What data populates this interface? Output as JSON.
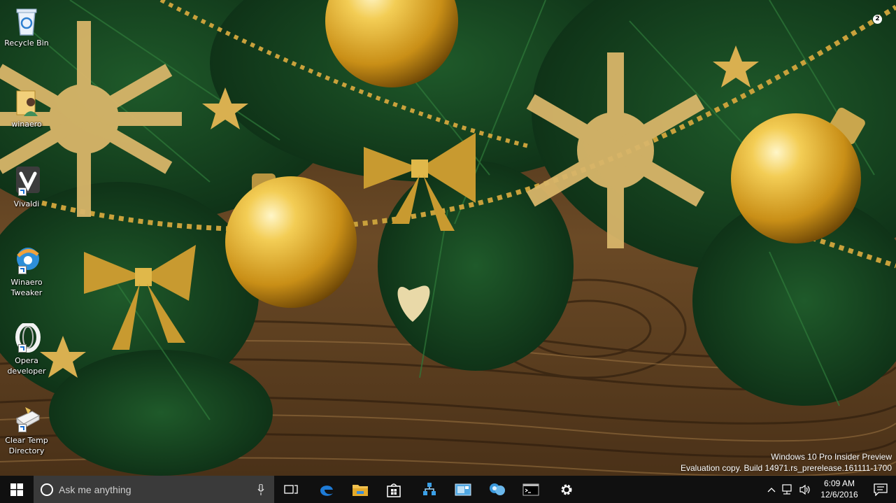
{
  "desktop": {
    "icons": [
      {
        "label": "Recycle Bin",
        "icon": "recycle-bin-icon"
      },
      {
        "label": "winaero",
        "icon": "user-folder-icon"
      },
      {
        "label": "Vivaldi",
        "icon": "vivaldi-icon"
      },
      {
        "label": "Winaero Tweaker",
        "icon": "winaero-tweaker-icon"
      },
      {
        "label": "Opera developer",
        "icon": "opera-icon"
      },
      {
        "label": "Clear Temp Directory",
        "icon": "clear-temp-icon"
      }
    ],
    "watermark": {
      "line1": "Windows 10 Pro Insider Preview",
      "line2": "Evaluation copy. Build 14971.rs_prerelease.161111-1700"
    }
  },
  "taskbar": {
    "search_placeholder": "Ask me anything",
    "pinned": [
      "task-view-icon",
      "edge-icon",
      "file-explorer-icon",
      "store-icon",
      "network-app-icon",
      "photos-app-icon",
      "people-app-icon",
      "command-prompt-icon",
      "settings-icon"
    ],
    "tray": [
      "show-hidden-icons",
      "network-icon",
      "volume-icon"
    ],
    "clock": {
      "time": "6:09 AM",
      "date": "12/6/2016"
    },
    "notifications_count": "2"
  },
  "colors": {
    "taskbar_bg": "#101010",
    "search_bg": "#3a3a3a",
    "edge_blue": "#1e7bd6",
    "explorer_yellow": "#f2c14e"
  }
}
